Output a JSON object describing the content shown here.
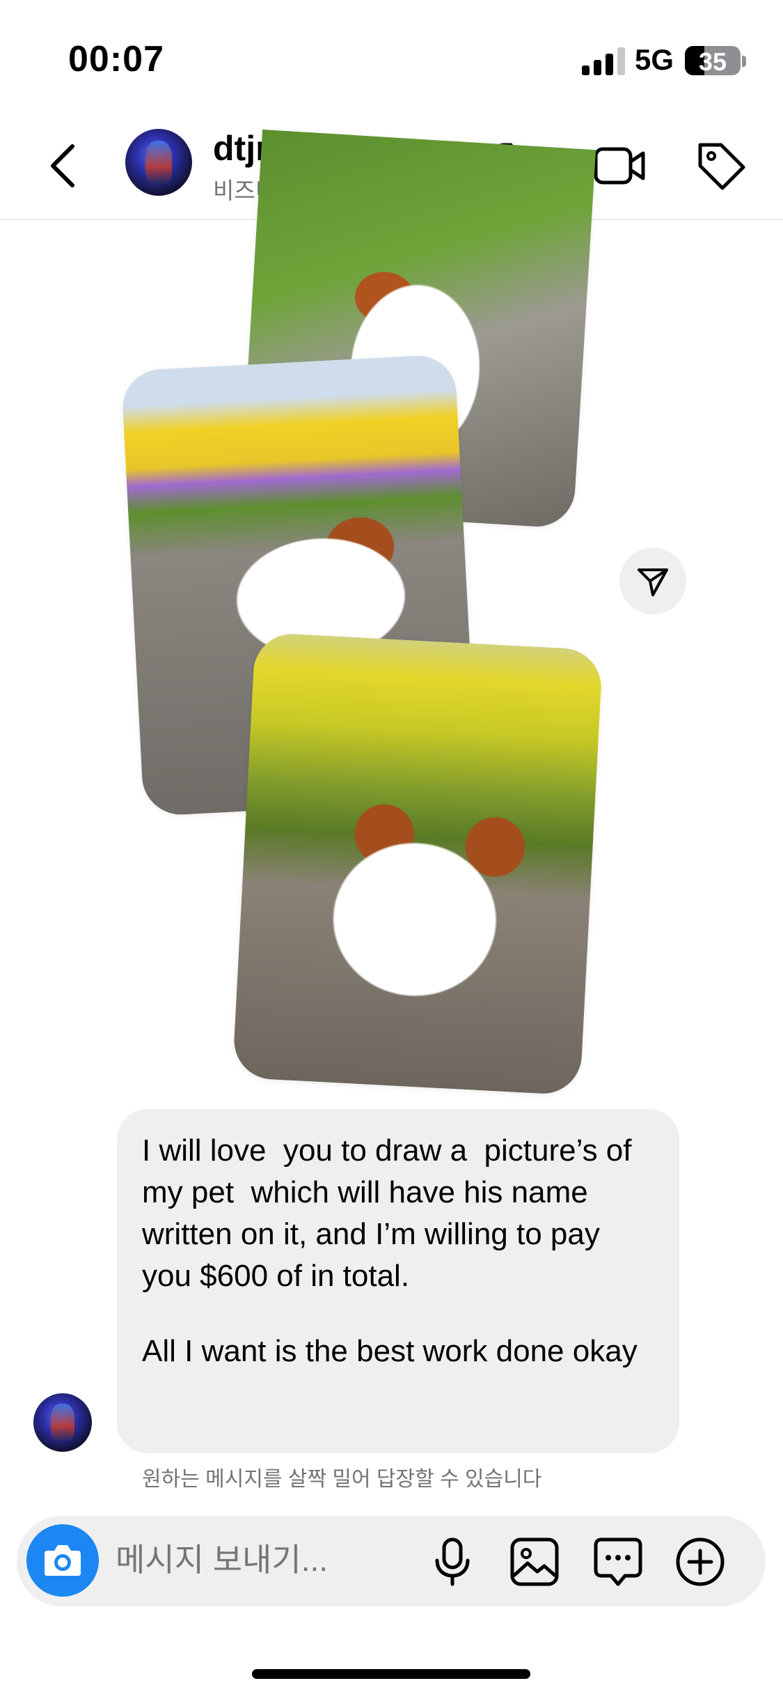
{
  "status_bar": {
    "time": "00:07",
    "network": "5G",
    "battery": "35"
  },
  "header": {
    "username": "dtjrhfg",
    "subtitle": "비즈니스 채팅",
    "icons": [
      "back-arrow-icon",
      "phone-icon",
      "video-camera-icon",
      "tag-icon"
    ]
  },
  "message": {
    "paragraph1": "I will love  you to draw a  picture’s of my pet  which will have his name written on it, and I’m willing to pay you $600 of in total.",
    "paragraph2": "All I want is the best work done okay"
  },
  "hint": "원하는 메시지를 살짝 밀어 답장할 수 있습니다",
  "composer": {
    "placeholder": "메시지 보내기...",
    "icons": [
      "camera-icon",
      "microphone-icon",
      "gallery-icon",
      "sticker-chat-icon",
      "plus-icon"
    ]
  },
  "colors": {
    "accent": "#1c87f2",
    "bubble": "#efeff0",
    "muted_text": "#737373"
  }
}
